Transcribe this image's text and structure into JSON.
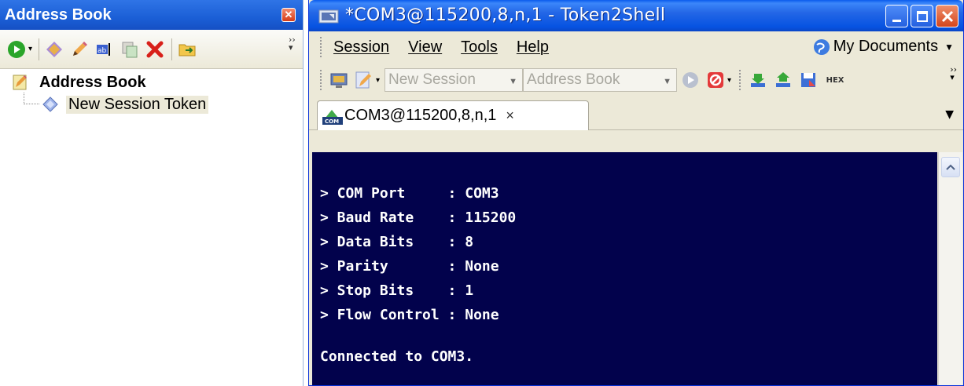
{
  "address_book": {
    "title": "Address Book",
    "close_glyph": "✕",
    "tree": {
      "root_label": "Address Book",
      "child_label": "New Session Token"
    }
  },
  "window": {
    "title": "*COM3@115200,8,n,1 - Token2Shell",
    "menu": [
      "Session",
      "View",
      "Tools",
      "Help"
    ],
    "my_documents": "My Documents",
    "combo_session": "New Session",
    "combo_address": "Address Book",
    "hex_label": "HEX",
    "tab": {
      "label": "COM3@115200,8,n,1",
      "close": "×",
      "icon_text": "COM"
    }
  },
  "terminal": {
    "lines": [
      "> COM Port     : COM3",
      "> Baud Rate    : 115200",
      "> Data Bits    : 8",
      "> Parity       : None",
      "> Stop Bits    : 1",
      "> Flow Control : None"
    ],
    "status": "Connected to COM3."
  },
  "colors": {
    "terminal_bg": "#02024c",
    "titlebar": "#0653e2",
    "chrome": "#ece9d8"
  }
}
